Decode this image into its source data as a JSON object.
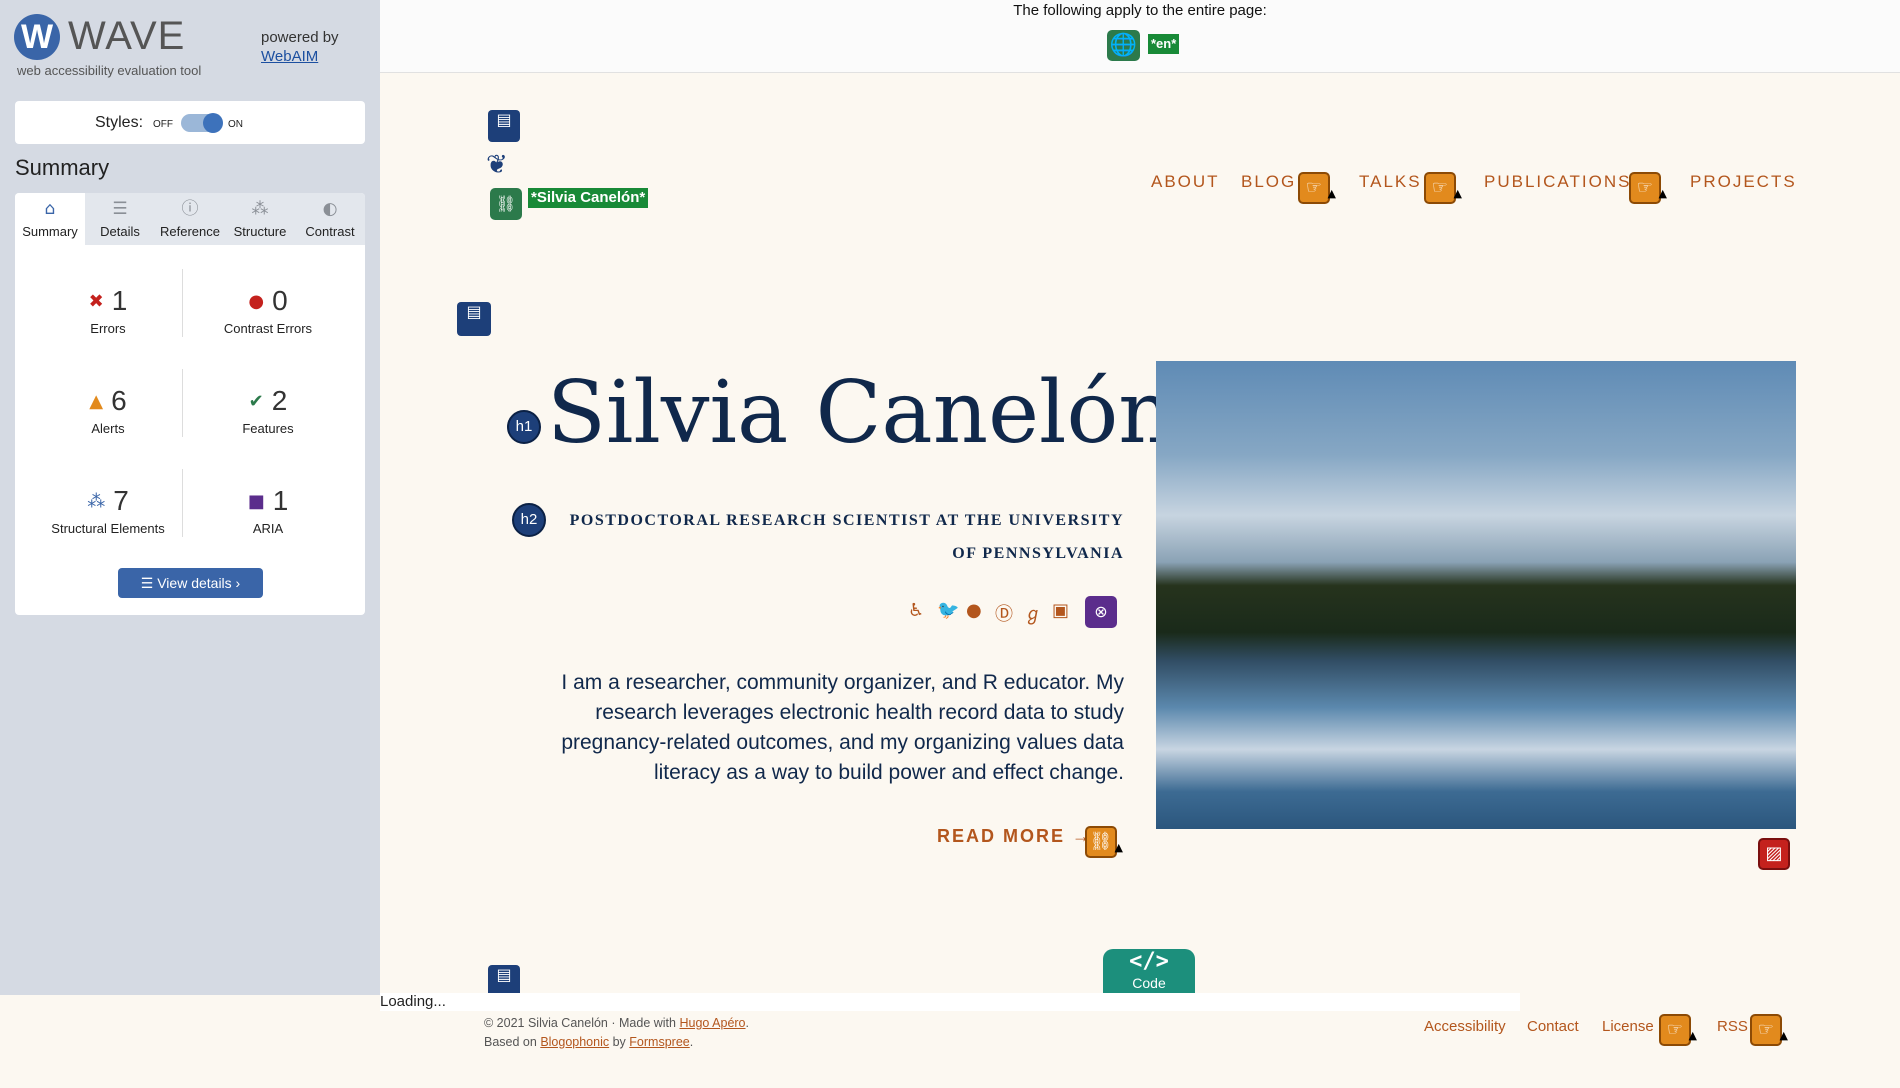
{
  "wave": {
    "logo_letter": "W",
    "brand": "WAVE",
    "tagline": "web accessibility evaluation tool",
    "powered_by": "powered by",
    "webaim": "WebAIM",
    "styles_label": "Styles:",
    "off": "OFF",
    "on": "ON",
    "summary_heading": "Summary",
    "tabs": [
      {
        "label": "Summary",
        "icon": "home-icon"
      },
      {
        "label": "Details",
        "icon": "list-icon"
      },
      {
        "label": "Reference",
        "icon": "info-icon"
      },
      {
        "label": "Structure",
        "icon": "structure-icon"
      },
      {
        "label": "Contrast",
        "icon": "contrast-icon"
      }
    ],
    "stats": [
      {
        "count": "1",
        "label": "Errors",
        "icon": "error-icon",
        "color": "#c4211d"
      },
      {
        "count": "0",
        "label": "Contrast Errors",
        "icon": "contrast-error-icon",
        "color": "#c4211d"
      },
      {
        "count": "6",
        "label": "Alerts",
        "icon": "alert-icon",
        "color": "#e28a1d"
      },
      {
        "count": "2",
        "label": "Features",
        "icon": "feature-icon",
        "color": "#2c7a4b"
      },
      {
        "count": "7",
        "label": "Structural Elements",
        "icon": "structure-icon",
        "color": "#3a65a8"
      },
      {
        "count": "1",
        "label": "ARIA",
        "icon": "aria-icon",
        "color": "#5b2d8c"
      }
    ],
    "view_details": "View details ›",
    "page_notice": "The following apply to the entire page:",
    "lang_tag": "*en*",
    "loading": "Loading..."
  },
  "site": {
    "logo_alt_tag": "*Silvia Canelón*",
    "nav": [
      "ABOUT",
      "BLOG",
      "TALKS",
      "PUBLICATIONS",
      "PROJECTS"
    ],
    "h1_badge": "h1",
    "h2_badge": "h2",
    "title": "Silvia Canelón",
    "subtitle": "Postdoctoral research scientist at the University of Pennsylvania",
    "bio": "I am a researcher, community organizer, and R educator. My research leverages electronic health record data to study pregnancy-related outcomes, and my organizing values data literacy as a way to build power and effect change.",
    "read_more": "READ MORE →",
    "code_tab": "Code",
    "footer": {
      "copyright": "© 2021 Silvia Canelón",
      "sep": "·",
      "made_with": "Made with",
      "hugo": "Hugo Apéro",
      "based_on": "Based on",
      "blogophonic": "Blogophonic",
      "by": "by",
      "formspree": "Formspree",
      "links": [
        "Accessibility",
        "Contact",
        "License",
        "RSS"
      ]
    }
  },
  "colors": {
    "accent": "#b3561d",
    "navy": "#10284b",
    "wave_blue": "#3a65a8"
  }
}
